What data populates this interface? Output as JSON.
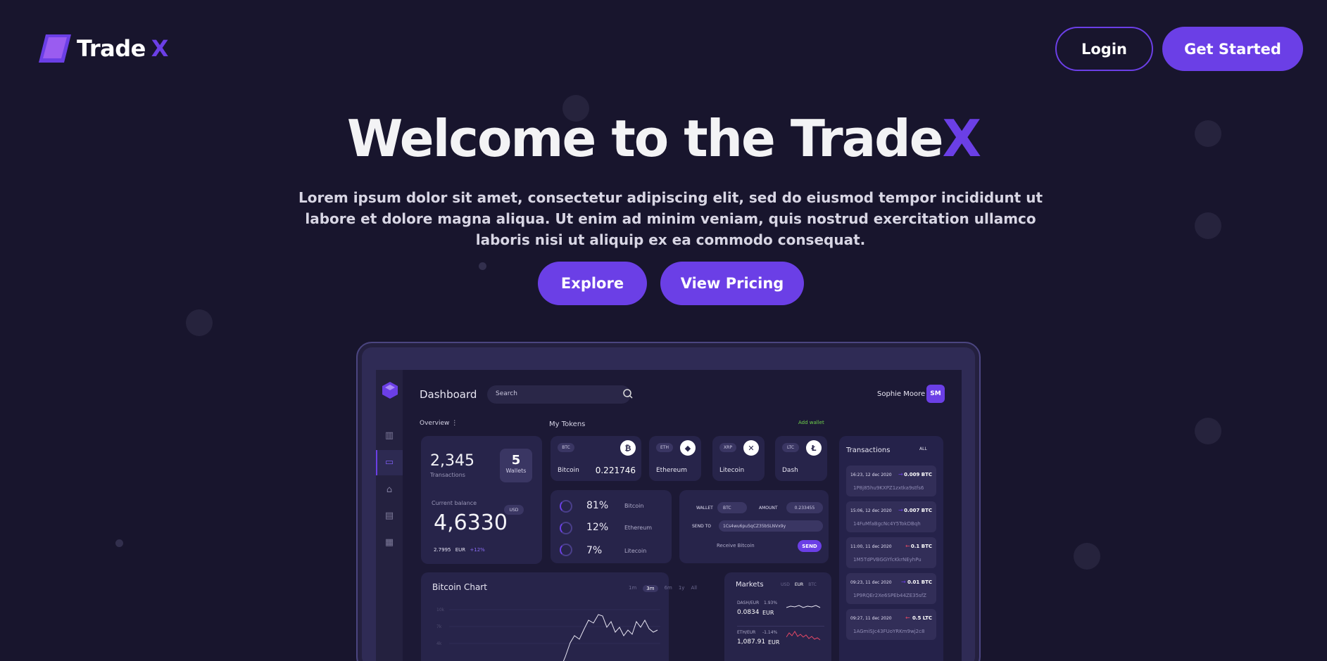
{
  "brand": {
    "name": "Trade",
    "suffix": "X"
  },
  "nav": {
    "login_label": "Login",
    "get_started_label": "Get Started"
  },
  "hero": {
    "title_main": "Welcome to the Trade",
    "title_accent": "X",
    "description": "Lorem ipsum dolor sit amet, consectetur adipiscing elit, sed do eiusmod tempor incididunt ut labore et dolore magna aliqua. Ut enim ad minim veniam, quis nostrud exercitation ullamco laboris nisi ut aliquip ex ea commodo consequat.",
    "explore_label": "Explore",
    "pricing_label": "View Pricing"
  },
  "colors": {
    "background": "#18152d",
    "accent": "#6b3fe6",
    "card": "#27244a"
  },
  "dashboard": {
    "title": "Dashboard",
    "search_placeholder": "Search",
    "user_name": "Sophie Moore",
    "user_initials": "SM",
    "overview_label": "Overview",
    "overview_menu": "⋮",
    "my_tokens_label": "My Tokens",
    "add_wallet_label": "Add wallet",
    "transactions_count": "2,345",
    "transactions_label": "Transactions",
    "wallets_count": "5",
    "wallets_label": "Wallets",
    "current_balance_label": "Current balance",
    "currency_badge": "USD",
    "balance_value": "4,6330",
    "balance_eur_value": "2.7995",
    "balance_eur_label": "EUR",
    "balance_change": "+12%",
    "tokens": [
      {
        "code": "BTC",
        "name": "Bitcoin",
        "amount": "0.221746",
        "icon": "bitcoin-icon",
        "glyph": "₿"
      },
      {
        "code": "ETH",
        "name": "Ethereum",
        "icon": "ethereum-icon",
        "glyph": "◆"
      },
      {
        "code": "XRP",
        "name": "Litecoin",
        "icon": "xrp-icon",
        "glyph": "✕"
      },
      {
        "code": "LTC",
        "name": "Dash",
        "icon": "litecoin-icon",
        "glyph": "Ł"
      }
    ],
    "allocation": [
      {
        "pct": "81%",
        "name": "Bitcoin"
      },
      {
        "pct": "12%",
        "name": "Ethereum"
      },
      {
        "pct": "7%",
        "name": "Litecoin"
      }
    ],
    "send_form": {
      "wallet_label": "WALLET",
      "wallet_value": "BTC",
      "amount_label": "AMOUNT",
      "amount_value": "0.233455",
      "send_to_label": "SEND TO",
      "send_to_value": "1Cs4wu6pu5qCZ35bSLNVx9y",
      "receive_label": "Receive Bitcoin",
      "send_button": "SEND"
    },
    "transactions": {
      "title": "Transactions",
      "filter": "ALL",
      "items": [
        {
          "time": "16:23, 12 dec 2020",
          "amount": "0.009 BTC",
          "hash": "1P8j85hu9KXPZ1zxtka9stfs6",
          "direction": "in"
        },
        {
          "time": "15:06, 12 dec 2020",
          "amount": "0.007 BTC",
          "hash": "14FuMfaBgcNc4Y5TokDBqh",
          "direction": "in"
        },
        {
          "time": "11:00, 11 dec 2020",
          "amount": "0.1 BTC",
          "hash": "1M5TdPVBGGYfcKkrNEyhPu",
          "direction": "out"
        },
        {
          "time": "09:23, 11 dec 2020",
          "amount": "0.01 BTC",
          "hash": "1P9RQEr2Xe6SPEb44ZE35sfZ",
          "direction": "in"
        },
        {
          "time": "09:27, 11 dec 2020",
          "amount": "0.5 LTC",
          "hash": "1AGmiSJc43FUoYRKm9wj2c8",
          "direction": "out"
        }
      ]
    },
    "bitcoin_chart": {
      "title": "Bitcoin Chart",
      "ranges": [
        "1m",
        "3m",
        "6m",
        "1y",
        "All"
      ],
      "selected_range": "3m",
      "y_ticks": [
        "10k",
        "7k",
        "4k"
      ]
    },
    "markets": {
      "title": "Markets",
      "currencies": [
        "USD",
        "EUR",
        "BTC"
      ],
      "selected_currency": "EUR",
      "items": [
        {
          "pair": "DASH/EUR",
          "change": "1.93%",
          "value": "0.0834",
          "unit": "EUR",
          "trend": "up"
        },
        {
          "pair": "ETH/EUR",
          "change": "-1.14%",
          "value": "1,087.91",
          "unit": "EUR",
          "trend": "down"
        }
      ]
    }
  }
}
